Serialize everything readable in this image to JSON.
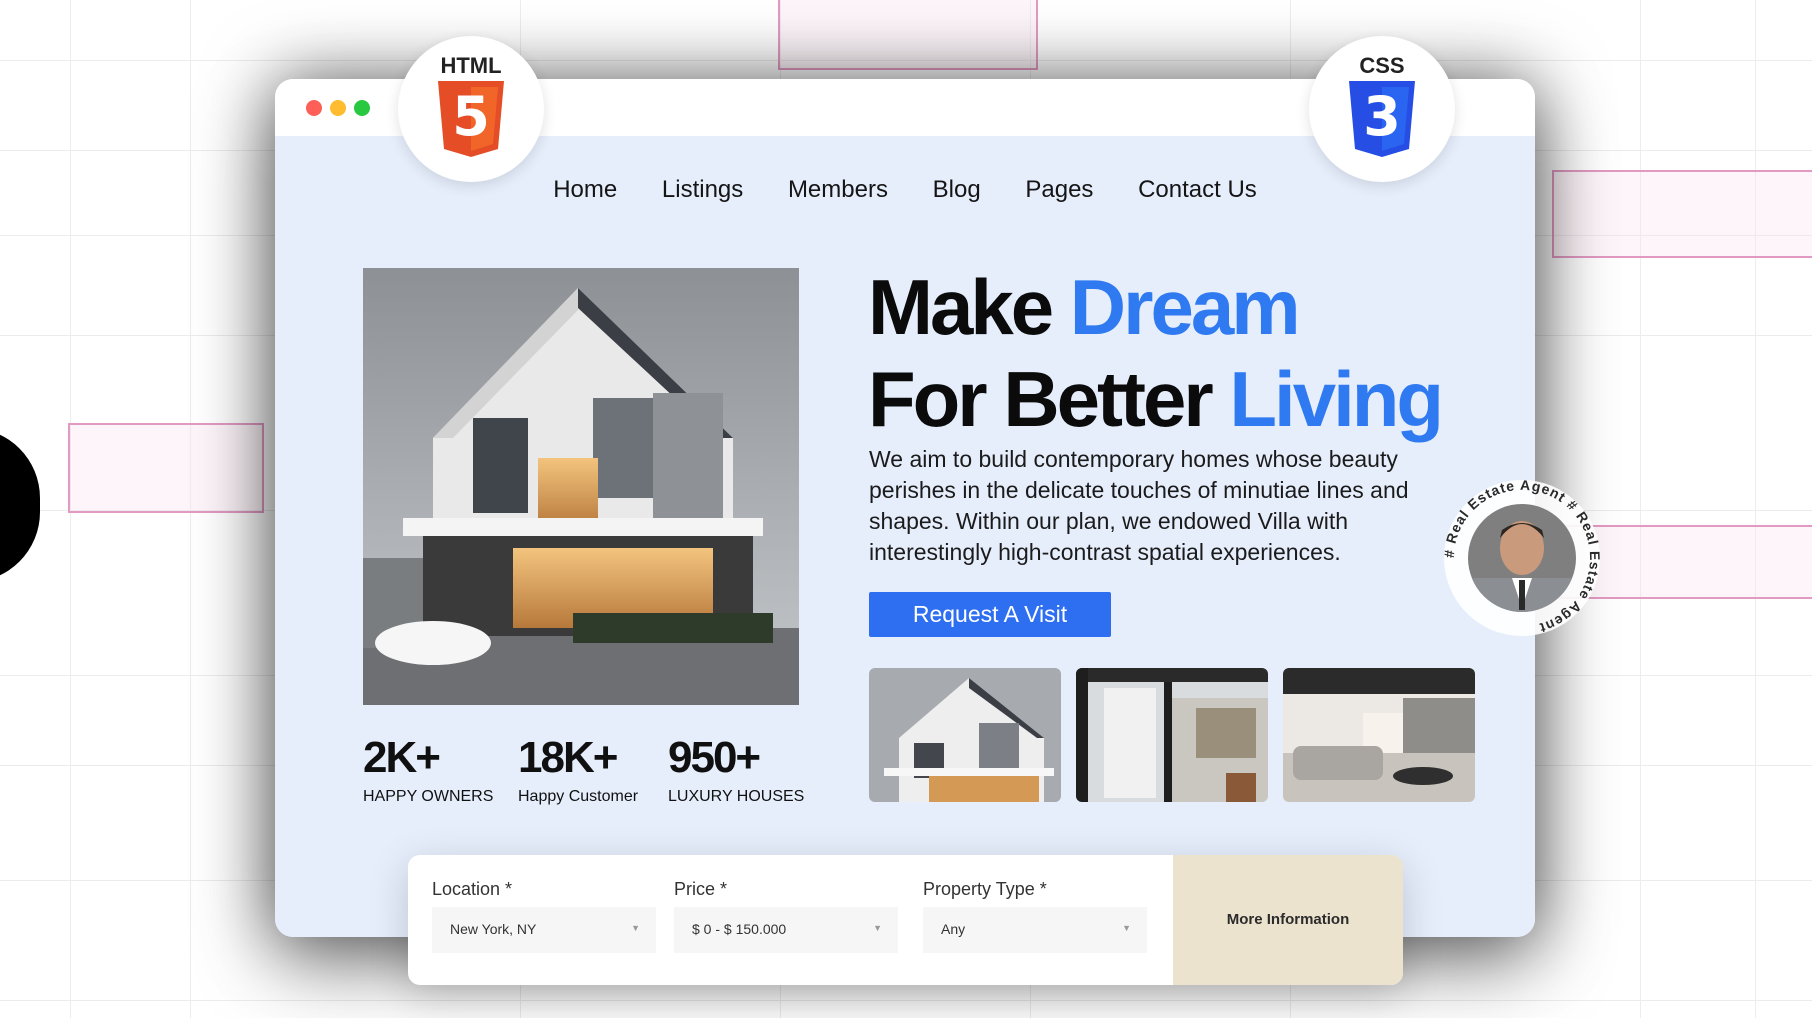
{
  "nav": {
    "items": [
      "Home",
      "Listings",
      "Members",
      "Blog",
      "Pages",
      "Contact Us"
    ]
  },
  "hero": {
    "headline_line1_dark": "Make ",
    "headline_line1_blue": "Dream",
    "headline_line2_dark": "For Better ",
    "headline_line2_blue": "Living",
    "description": "We aim to build contemporary homes whose beauty perishes in the delicate touches of minutiae lines and shapes. Within our plan, we endowed Villa with interestingly high-contrast spatial experiences.",
    "cta_label": "Request A Visit"
  },
  "stats": [
    {
      "value": "2K+",
      "label": "HAPPY OWNERS"
    },
    {
      "value": "18K+",
      "label": "Happy Customer"
    },
    {
      "value": "950+",
      "label": "LUXURY HOUSES"
    }
  ],
  "search": {
    "location_label": "Location *",
    "location_value": "New York, NY",
    "price_label": "Price *",
    "price_value": "$ 0 - $ 150.000",
    "type_label": "Property Type *",
    "type_value": "Any",
    "more_label": "More Information"
  },
  "badges": {
    "html": "HTML",
    "html_number": "5",
    "css": "CSS",
    "css_number": "3"
  },
  "agent_ring_text": "# Real Estate Agent # Real Estate Agent ",
  "colors": {
    "accent_blue": "#2f7af0",
    "button_blue": "#2e6ff2",
    "page_bg": "#e6eefc",
    "more_bg": "#ece3cf",
    "html_orange": "#e44d26",
    "css_blue": "#264de4"
  }
}
